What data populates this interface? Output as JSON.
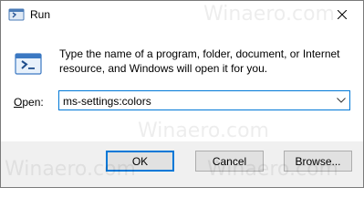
{
  "window": {
    "title": "Run",
    "close_icon": "close-icon"
  },
  "description": "Type the name of a program, folder, document, or Internet resource, and Windows will open it for you.",
  "open": {
    "label_accel": "O",
    "label_rest": "pen:",
    "value": "ms-settings:colors"
  },
  "buttons": {
    "ok": "OK",
    "cancel": "Cancel",
    "browse": "Browse..."
  },
  "watermark": "Winaero.com",
  "colors": {
    "accent": "#0078d7",
    "footer": "#f0f0f0",
    "button": "#e1e1e1"
  }
}
